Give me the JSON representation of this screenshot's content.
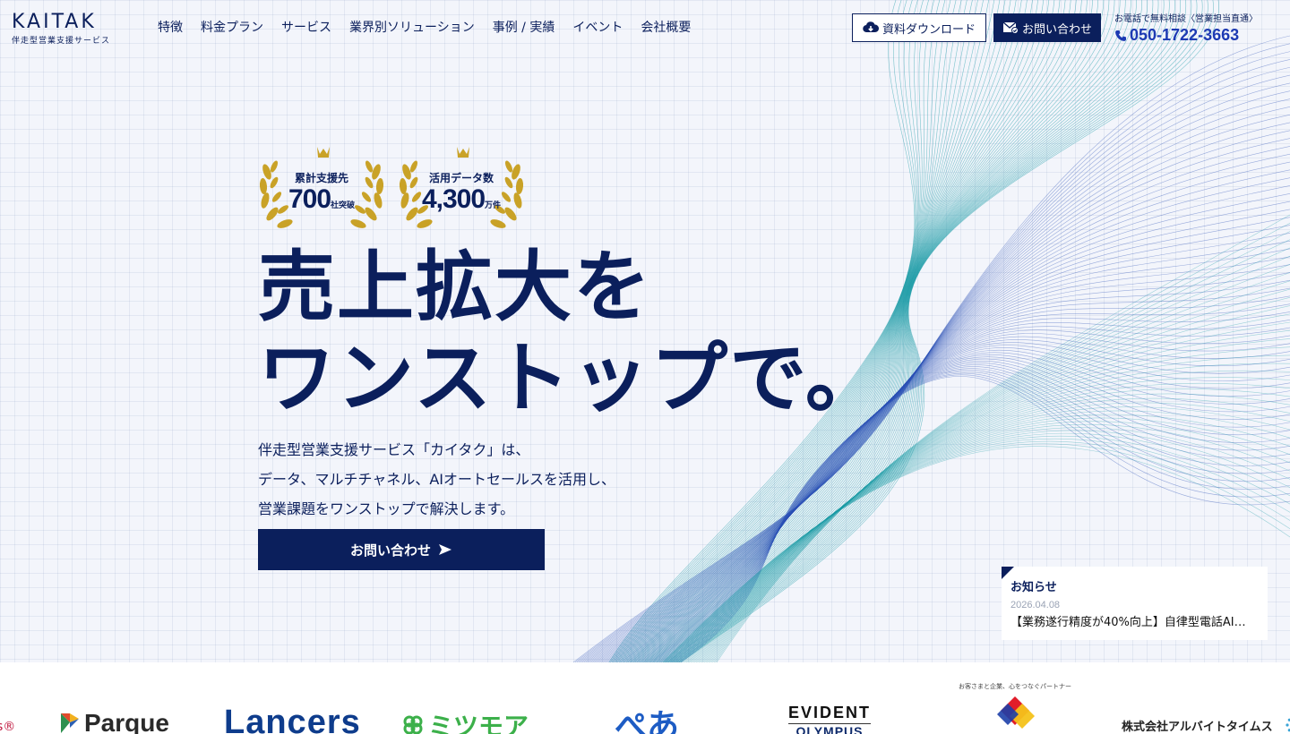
{
  "header": {
    "logo": "KAITAK",
    "logo_sub": "伴走型営業支援サービス",
    "nav": [
      "特徴",
      "料金プラン",
      "サービス",
      "業界別ソリューション",
      "事例 / 実績",
      "イベント",
      "会社概要"
    ],
    "download_label": "資料ダウンロード",
    "contact_label": "お問い合わせ",
    "phone_label": "お電話で無料相談〈営業担当直通〉",
    "phone_number": "050-1722-3663"
  },
  "awards": [
    {
      "label": "累計支援先",
      "value": "700",
      "unit": "社突破"
    },
    {
      "label": "活用データ数",
      "value": "4,300",
      "unit": "万件"
    }
  ],
  "hero": {
    "headline_line1": "売上拡大を",
    "headline_line2": "ワンストップで。",
    "desc_line1": "伴走型営業支援サービス「カイタク」は、",
    "desc_line2": "データ、マルチチャネル、AIオートセールスを活用し、",
    "desc_line3": "営業課題をワンストップで解決します。",
    "cta_label": "お問い合わせ"
  },
  "news": {
    "title": "お知らせ",
    "date": "2026.04.08",
    "text": "【業務遂行精度が40%向上】自律型電話AI…"
  },
  "clients": {
    "parque": "Parque",
    "lancers": "Lancers",
    "mitsumore": "ミツモア",
    "pepa": "ぺあ",
    "evident_top": "EVIDENT",
    "evident_bottom": "OLYMPUS",
    "partner_tagline": "お客さまと企業、心をつなぐパートナー",
    "albatimes": "株式会社アルバイトタイムス"
  },
  "colors": {
    "navy": "#0b1f5c",
    "phone_blue": "#1d3ab3",
    "gold": "#c9a227",
    "wave_teal": "#1a9aa5",
    "wave_blue": "#2a4fb5"
  }
}
